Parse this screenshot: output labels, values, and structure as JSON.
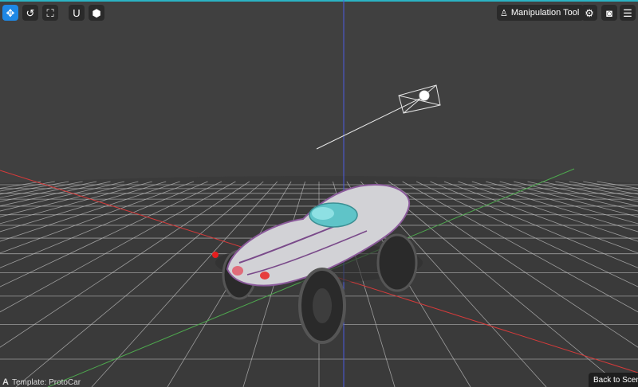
{
  "toolbar_left": [
    {
      "name": "move-tool-button",
      "icon": "move-arrows-icon",
      "glyph": "✥",
      "active": true
    },
    {
      "name": "undo-button",
      "icon": "undo-icon",
      "glyph": "↺",
      "active": false
    },
    {
      "name": "fit-view-button",
      "icon": "expand-corners-icon",
      "glyph": "⛶",
      "active": false
    },
    {
      "name": "snap-magnet-button",
      "icon": "magnet-icon",
      "glyph": "U",
      "active": false
    },
    {
      "name": "object-cube-button",
      "icon": "cube-icon",
      "glyph": "⬢",
      "active": false
    }
  ],
  "tool_label": {
    "icon": "manipulation-joystick-icon",
    "glyph": "♙",
    "text": "Manipulation Tool"
  },
  "toolbar_right": [
    {
      "name": "settings-gears-button",
      "icon": "gears-icon",
      "glyph": "⚙",
      "active": false
    },
    {
      "name": "screenshot-camera-button",
      "icon": "camera-icon",
      "glyph": "◙",
      "active": false
    },
    {
      "name": "options-sliders-button",
      "icon": "sliders-icon",
      "glyph": "☰",
      "active": false
    }
  ],
  "footer": {
    "template_icon": "letter-a-icon",
    "template_glyph": "A",
    "template_text": "Template: ProtoCar",
    "back_button": "Back to Scene"
  },
  "colors": {
    "accent": "#1e88e5",
    "topline": "#2bb3c4",
    "x_axis": "#d83a3a",
    "z_axis": "#4ea84e",
    "y_axis": "#4b5be0"
  }
}
